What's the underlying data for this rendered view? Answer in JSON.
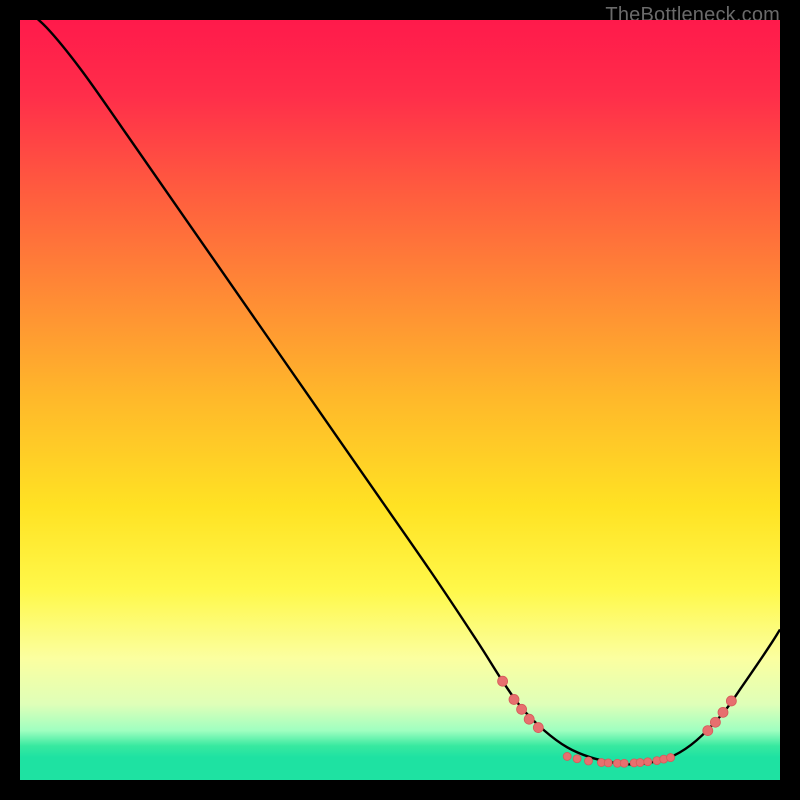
{
  "watermark": "TheBottleneck.com",
  "colors": {
    "gradient_stops": [
      {
        "offset": 0.0,
        "color": "#ff1a4b"
      },
      {
        "offset": 0.1,
        "color": "#ff2e4a"
      },
      {
        "offset": 0.22,
        "color": "#ff5a3f"
      },
      {
        "offset": 0.36,
        "color": "#ff8a35"
      },
      {
        "offset": 0.5,
        "color": "#ffb92a"
      },
      {
        "offset": 0.64,
        "color": "#ffe223"
      },
      {
        "offset": 0.75,
        "color": "#fff84a"
      },
      {
        "offset": 0.84,
        "color": "#fbffa0"
      },
      {
        "offset": 0.9,
        "color": "#dfffb8"
      },
      {
        "offset": 0.935,
        "color": "#9fffc0"
      },
      {
        "offset": 0.955,
        "color": "#38e9a0"
      },
      {
        "offset": 0.97,
        "color": "#1ee2a2"
      },
      {
        "offset": 1.0,
        "color": "#1ee2a2"
      }
    ],
    "curve": "#000000",
    "marker_fill": "#e76f6f",
    "marker_stroke": "#d65a5a"
  },
  "chart_data": {
    "type": "line",
    "title": "",
    "xlabel": "",
    "ylabel": "",
    "xlim": [
      0,
      100
    ],
    "ylim": [
      0,
      100
    ],
    "note": "No axes or tick labels are rendered; values are in normalized 0–100 space inferred from pixel positions of the plotted curve and markers.",
    "series": [
      {
        "name": "bottleneck-curve",
        "x": [
          0,
          3.5,
          8,
          14,
          22,
          30,
          38,
          46,
          54,
          60,
          63.5,
          66,
          69,
          72,
          75,
          78,
          80.5,
          83,
          86,
          89,
          92.5,
          95,
          97,
          99,
          100
        ],
        "y": [
          102,
          99,
          93.5,
          85,
          73.5,
          62,
          50.5,
          39,
          27.5,
          18.5,
          13,
          9.5,
          6.5,
          4.3,
          3,
          2.3,
          2.05,
          2.3,
          3.2,
          5.2,
          8.8,
          12.3,
          15.2,
          18.2,
          19.8
        ]
      }
    ],
    "markers": {
      "name": "highlighted-points",
      "points": [
        {
          "x": 63.5,
          "y": 13.0,
          "r": 5
        },
        {
          "x": 65.0,
          "y": 10.6,
          "r": 5
        },
        {
          "x": 66.0,
          "y": 9.3,
          "r": 5
        },
        {
          "x": 67.0,
          "y": 8.0,
          "r": 5
        },
        {
          "x": 68.2,
          "y": 6.9,
          "r": 5
        },
        {
          "x": 72.0,
          "y": 3.1,
          "r": 4
        },
        {
          "x": 73.3,
          "y": 2.8,
          "r": 4
        },
        {
          "x": 74.8,
          "y": 2.5,
          "r": 4
        },
        {
          "x": 76.5,
          "y": 2.3,
          "r": 4
        },
        {
          "x": 77.4,
          "y": 2.25,
          "r": 4
        },
        {
          "x": 78.6,
          "y": 2.2,
          "r": 4
        },
        {
          "x": 79.5,
          "y": 2.2,
          "r": 4
        },
        {
          "x": 80.8,
          "y": 2.25,
          "r": 4
        },
        {
          "x": 81.6,
          "y": 2.3,
          "r": 4
        },
        {
          "x": 82.6,
          "y": 2.4,
          "r": 4
        },
        {
          "x": 83.8,
          "y": 2.55,
          "r": 4
        },
        {
          "x": 84.7,
          "y": 2.75,
          "r": 4
        },
        {
          "x": 85.6,
          "y": 2.95,
          "r": 4
        },
        {
          "x": 90.5,
          "y": 6.5,
          "r": 5
        },
        {
          "x": 91.5,
          "y": 7.6,
          "r": 5
        },
        {
          "x": 92.5,
          "y": 8.9,
          "r": 5
        },
        {
          "x": 93.6,
          "y": 10.4,
          "r": 5
        }
      ]
    }
  }
}
